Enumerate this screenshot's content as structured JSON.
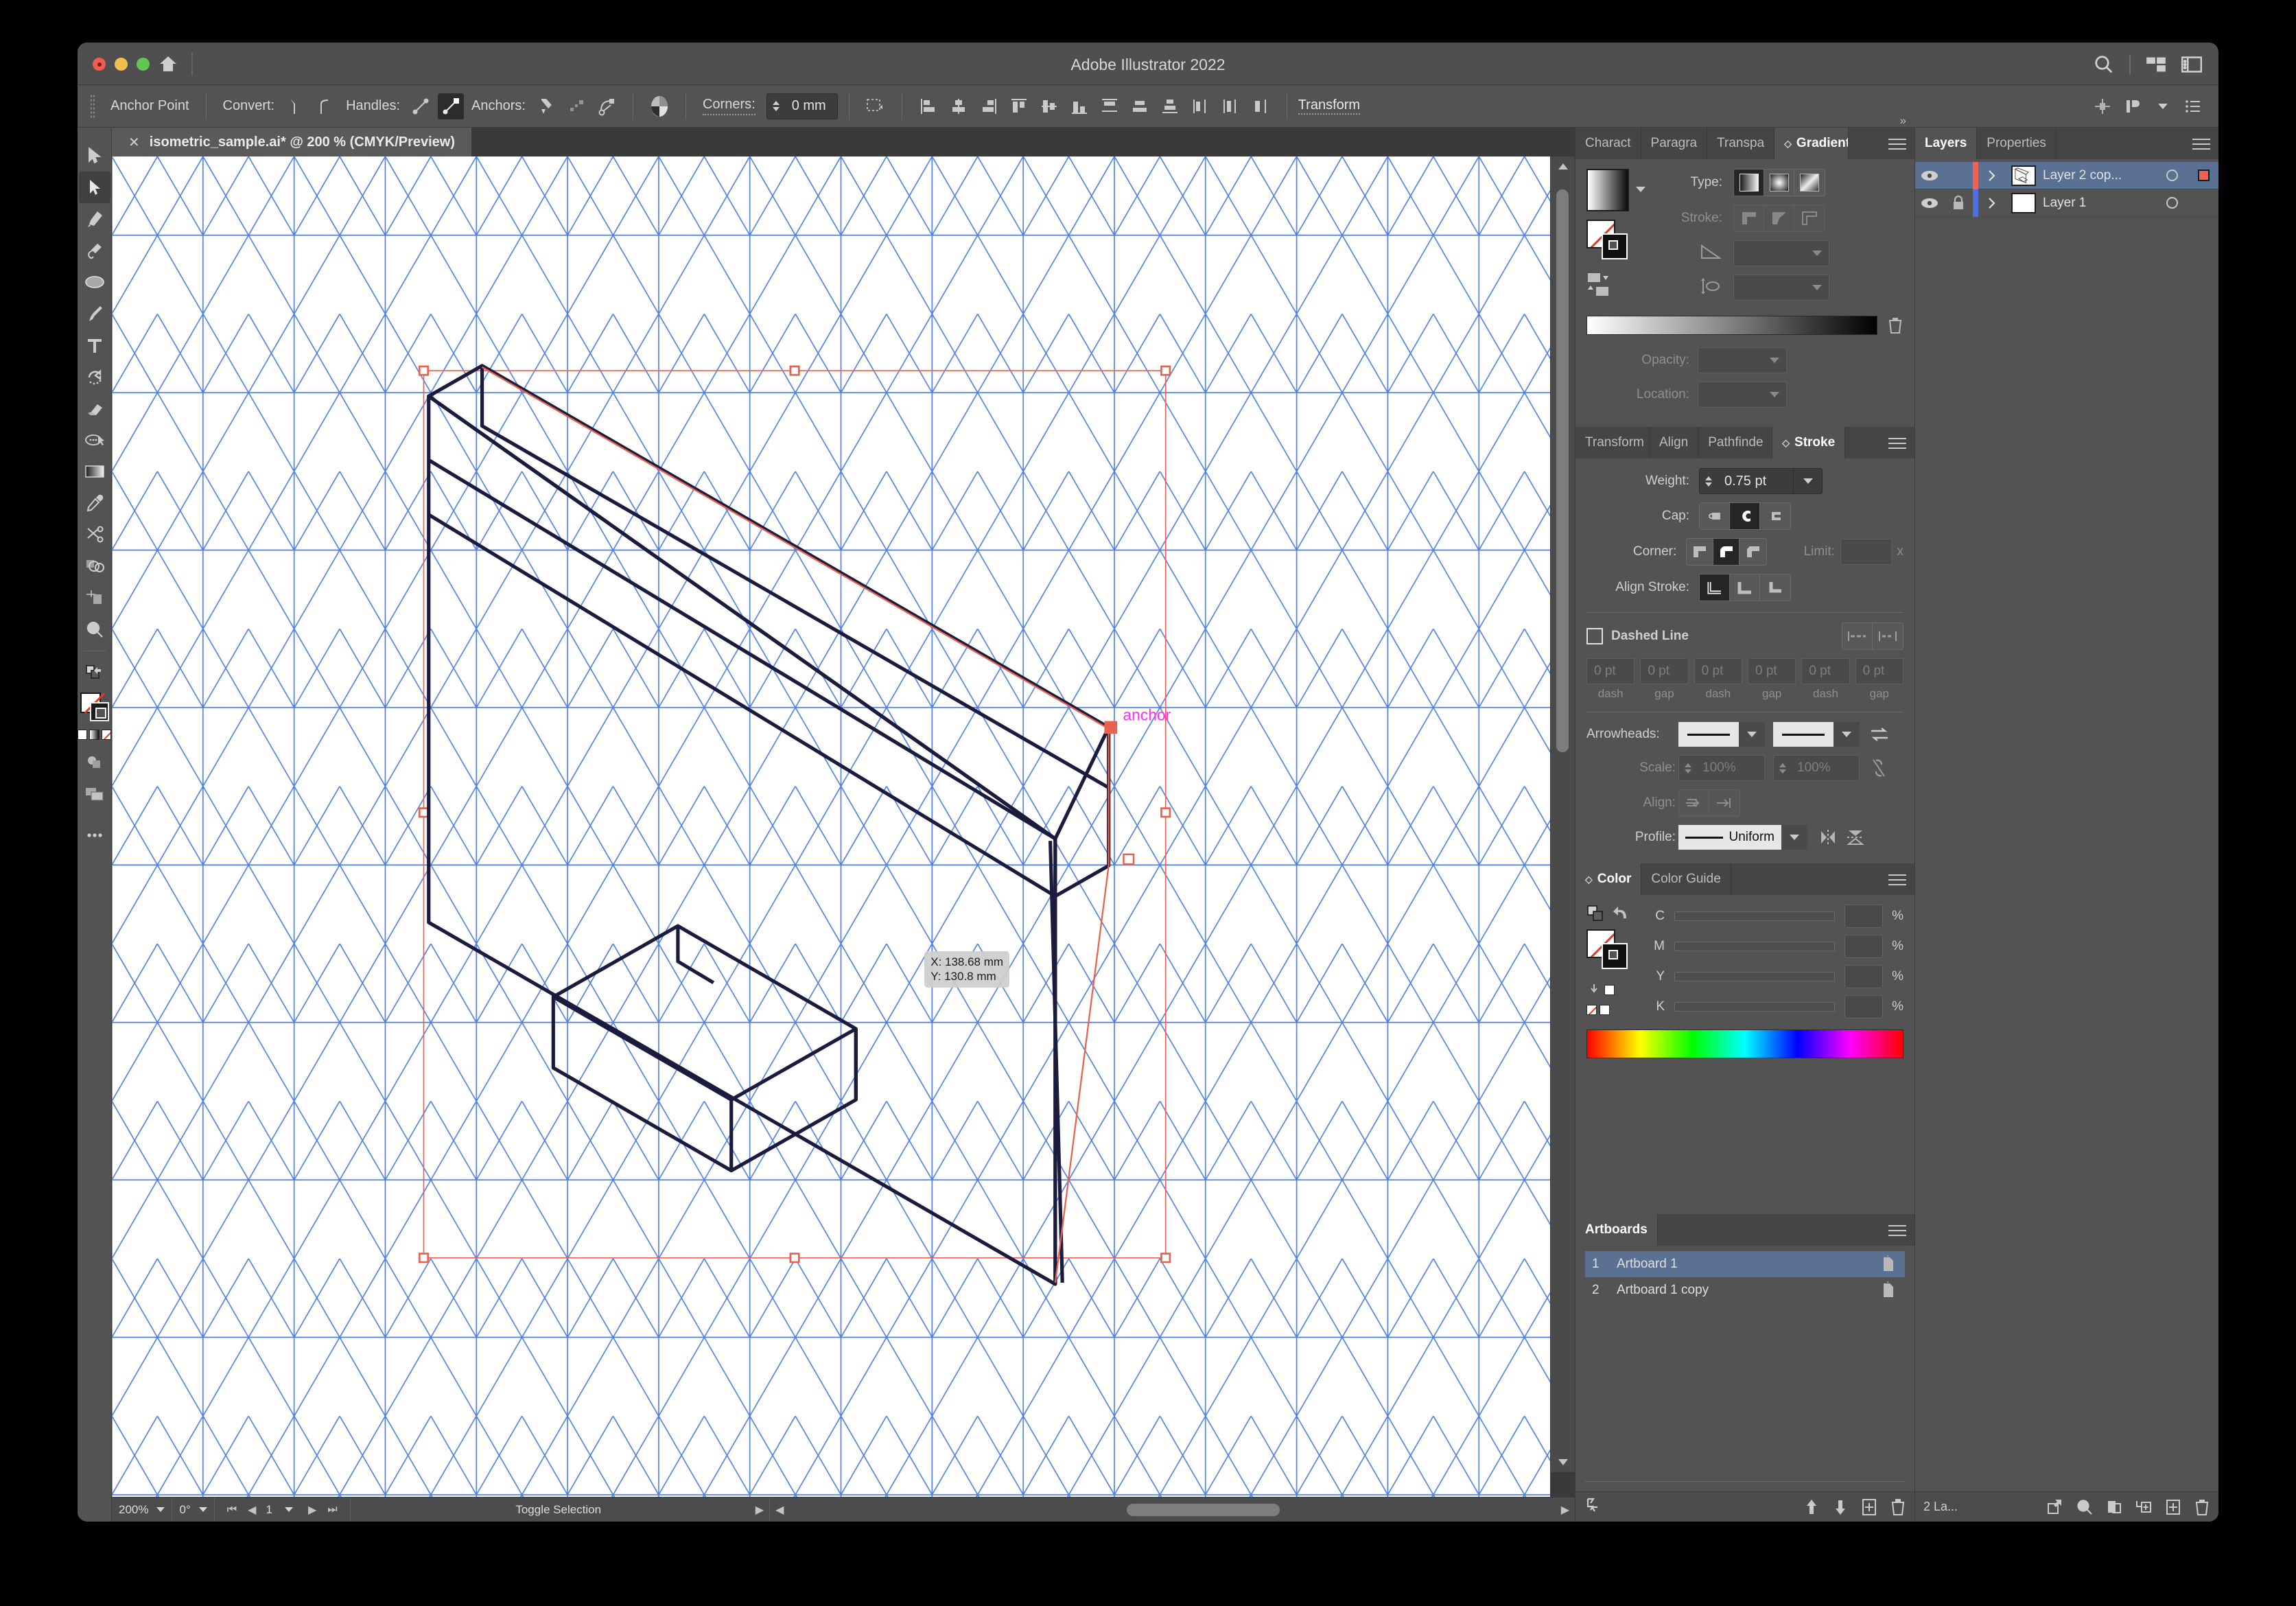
{
  "window": {
    "title": "Adobe Illustrator 2022",
    "traffic": [
      "close",
      "minimize",
      "zoom"
    ],
    "right_icons": [
      "search-icon",
      "arrange-documents-icon",
      "properties-panel-icon"
    ]
  },
  "control_bar": {
    "object_label": "Anchor Point",
    "convert_label": "Convert:",
    "handles_label": "Handles:",
    "anchors_label": "Anchors:",
    "corners_label": "Corners:",
    "corners_value": "0 mm",
    "transform_label": "Transform",
    "align_icons": [
      "align-left-icon",
      "align-horizontal-center-icon",
      "align-right-icon",
      "align-top-icon",
      "align-vertical-center-icon",
      "align-bottom-icon",
      "distribute-top-icon",
      "distribute-vertical-center-icon",
      "distribute-bottom-icon",
      "distribute-left-icon",
      "distribute-horizontal-center-icon",
      "distribute-right-icon"
    ],
    "right_icons": [
      "artboards-icon",
      "arrange-icon",
      "chevron-down-icon",
      "options-menu-icon"
    ]
  },
  "document": {
    "tab_title": "isometric_sample.ai* @ 200 % (CMYK/Preview)",
    "close_icon": "close-icon"
  },
  "tools": [
    {
      "name": "selection-tool",
      "active": false
    },
    {
      "name": "direct-selection-tool",
      "active": true
    },
    {
      "name": "pen-tool",
      "active": false
    },
    {
      "name": "curvature-tool",
      "active": false
    },
    {
      "name": "ellipse-tool",
      "active": false
    },
    {
      "name": "paintbrush-tool",
      "active": false
    },
    {
      "name": "type-tool",
      "active": false
    },
    {
      "name": "rotate-tool",
      "active": false
    },
    {
      "name": "eraser-tool",
      "active": false
    },
    {
      "name": "shaper-tool",
      "active": false
    },
    {
      "name": "gradient-tool",
      "active": false
    },
    {
      "name": "eyedropper-tool",
      "active": false
    },
    {
      "name": "scissors-tool",
      "active": false
    },
    {
      "name": "shape-builder-tool",
      "active": false
    },
    {
      "name": "artboard-tool",
      "active": false
    },
    {
      "name": "zoom-tool",
      "active": false
    }
  ],
  "canvas": {
    "smart_guide_label": "anchor",
    "tooltip_x": "X: 138.68 mm",
    "tooltip_y": "Y: 130.8 mm",
    "grid_color": "#4f7fe0",
    "selection_color": "#e8624f",
    "artwork_stroke": "#1b1b3d"
  },
  "status_bar": {
    "zoom": "200%",
    "rotation": "0°",
    "artboard_number": "1",
    "tool_hint": "Toggle Selection"
  },
  "gradient_panel": {
    "tabs": [
      {
        "label": "Charact",
        "active": false
      },
      {
        "label": "Paragra",
        "active": false
      },
      {
        "label": "Transpa",
        "active": false
      },
      {
        "label": "Gradient",
        "active": true
      }
    ],
    "type_label": "Type:",
    "type_icons": [
      "linear-gradient-icon",
      "radial-gradient-icon",
      "freeform-gradient-icon"
    ],
    "stroke_label": "Stroke:",
    "stroke_icons": [
      "stroke-within-icon",
      "stroke-along-icon",
      "stroke-across-icon"
    ],
    "angle_icon": "angle-icon",
    "aspect_icon": "aspect-ratio-icon",
    "opacity_label": "Opacity:",
    "location_label": "Location:",
    "delete_stop_icon": "trash-icon"
  },
  "stroke_panel": {
    "tabs": [
      {
        "label": "Transform",
        "active": false
      },
      {
        "label": "Align",
        "active": false
      },
      {
        "label": "Pathfinde",
        "active": false
      },
      {
        "label": "Stroke",
        "active": true
      }
    ],
    "weight_label": "Weight:",
    "weight_value": "0.75 pt",
    "cap_label": "Cap:",
    "cap_icons": [
      "butt-cap-icon",
      "round-cap-icon",
      "projecting-cap-icon"
    ],
    "cap_selected": 1,
    "corner_label": "Corner:",
    "corner_icons": [
      "miter-join-icon",
      "round-join-icon",
      "bevel-join-icon"
    ],
    "corner_selected": 1,
    "limit_label": "Limit:",
    "limit_suffix": "x",
    "align_stroke_label": "Align Stroke:",
    "align_stroke_icons": [
      "align-center-stroke-icon",
      "align-inside-stroke-icon",
      "align-outside-stroke-icon"
    ],
    "align_stroke_selected": 0,
    "dashed_label": "Dashed Line",
    "dashed_checked": false,
    "dash_corner_icons": [
      "dash-preserve-icon",
      "dash-adjust-icon"
    ],
    "dash_values": [
      "0 pt",
      "0 pt",
      "0 pt",
      "0 pt",
      "0 pt",
      "0 pt"
    ],
    "dash_captions": [
      "dash",
      "gap",
      "dash",
      "gap",
      "dash",
      "gap"
    ],
    "arrowheads_label": "Arrowheads:",
    "swap_icon": "swap-arrowheads-icon",
    "scale_label": "Scale:",
    "scale_values": [
      "100%",
      "100%"
    ],
    "link_icon": "link-broken-icon",
    "align_label": "Align:",
    "align_icons": [
      "extend-arrow-icon",
      "place-arrow-icon"
    ],
    "profile_label": "Profile:",
    "profile_value": "Uniform",
    "flip_icons": [
      "flip-horizontal-icon",
      "flip-vertical-icon"
    ]
  },
  "color_panel": {
    "tabs": [
      {
        "label": "Color",
        "active": true
      },
      {
        "label": "Color Guide",
        "active": false
      }
    ],
    "channels": [
      "C",
      "M",
      "Y",
      "K"
    ],
    "percent_suffix": "%",
    "none_swatch_icon": "none-swatch-icon",
    "swap_icon": "swap-fill-stroke-icon",
    "spectrum_icon": "color-spectrum-bar"
  },
  "layers_panel": {
    "tabs": [
      {
        "label": "Layers",
        "active": true
      },
      {
        "label": "Properties",
        "active": false
      }
    ],
    "rows": [
      {
        "name": "Layer 2 cop...",
        "visible": true,
        "locked": false,
        "selected": true,
        "color": "#f26052",
        "has_target_selection": true
      },
      {
        "name": "Layer 1",
        "visible": true,
        "locked": true,
        "selected": false,
        "color": "#4d6fe0",
        "has_target_selection": false
      }
    ],
    "footer_count": "2 La...",
    "footer_icons": [
      "release-to-layers-icon",
      "locate-object-icon",
      "make-clipping-mask-icon",
      "create-sublayer-icon",
      "new-layer-icon",
      "delete-layer-icon"
    ]
  },
  "artboards_panel": {
    "title": "Artboards",
    "rows": [
      {
        "number": "1",
        "name": "Artboard 1",
        "selected": true
      },
      {
        "number": "2",
        "name": "Artboard 1 copy",
        "selected": false
      }
    ],
    "footer_icons": [
      "rearrange-artboards-icon",
      "move-up-icon",
      "move-down-icon",
      "new-artboard-icon",
      "delete-artboard-icon"
    ]
  }
}
